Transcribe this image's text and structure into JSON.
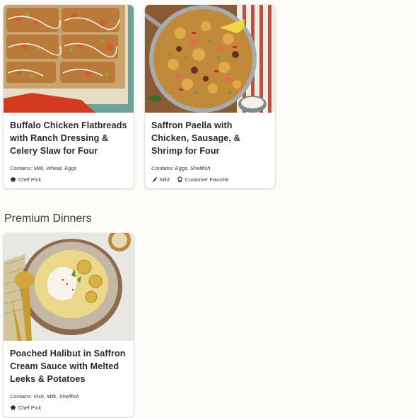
{
  "cards": [
    {
      "title": "Buffalo Chicken Flatbreads with Ranch Dressing & Celery Slaw for Four",
      "contains": "Contains: Milk, Wheat, Eggs",
      "tags": [
        "Chef Pick"
      ],
      "image_icon": "buffalo-chicken-flatbread-photo"
    },
    {
      "title": "Saffron Paella with Chicken, Sausage, & Shrimp for Four",
      "contains": "Contains: Eggs, Shellfish",
      "tags": [
        "Mild",
        "Customer Favorite"
      ],
      "image_icon": "saffron-paella-photo"
    }
  ],
  "section": {
    "title": "Premium Dinners"
  },
  "premium_cards": [
    {
      "title": "Poached Halibut in Saffron Cream Sauce with Melted Leeks & Potatoes",
      "contains": "Contains: Fish, Milk, Shellfish",
      "tags": [
        "Chef Pick"
      ],
      "image_icon": "poached-halibut-photo"
    }
  ],
  "colors": {
    "page_bg": "#fdfcf9",
    "card_bg": "#ffffff",
    "title_text": "#2a2a2a"
  }
}
